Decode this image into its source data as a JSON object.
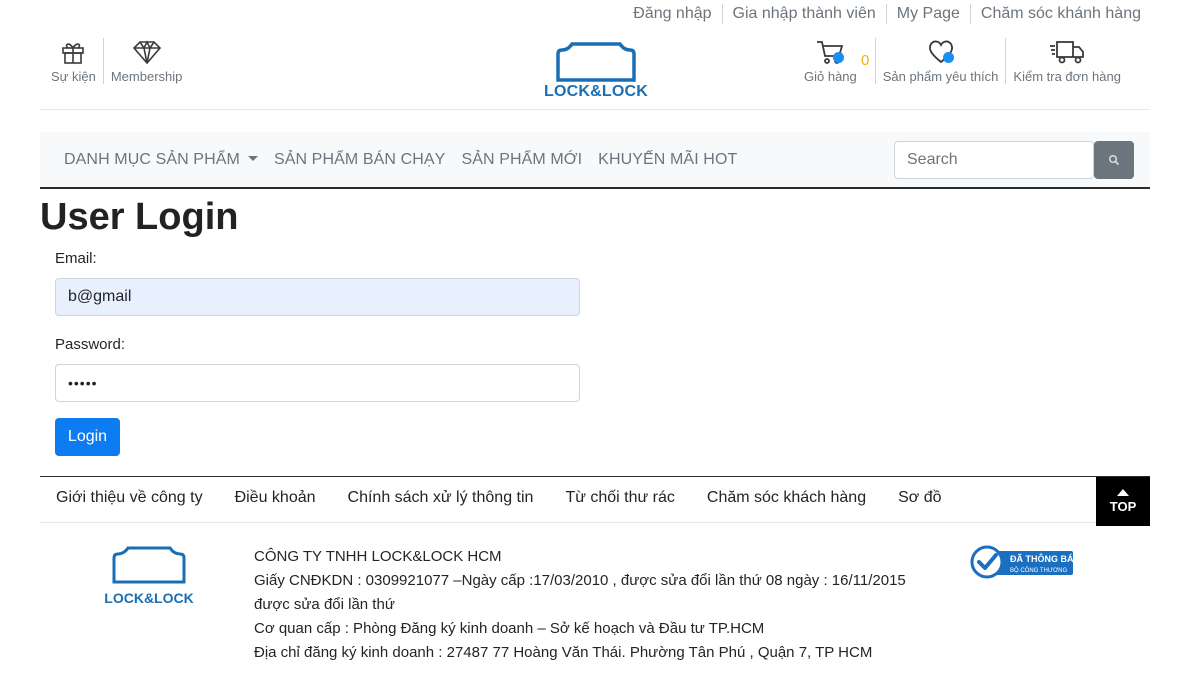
{
  "top_links": [
    "Đăng nhập",
    "Gia nhập thành viên",
    "My Page",
    "Chăm sóc khánh hàng"
  ],
  "header_left": [
    {
      "label": "Sự kiện",
      "icon": "gift-icon"
    },
    {
      "label": "Membership",
      "icon": "diamond-icon"
    }
  ],
  "logo": {
    "brand": "LOCK&LOCK"
  },
  "header_right": [
    {
      "label": "Giỏ hàng",
      "icon": "cart-icon",
      "count": "0"
    },
    {
      "label": "Sản phẩm yêu thích",
      "icon": "heart-icon"
    },
    {
      "label": "Kiểm tra đơn hàng",
      "icon": "truck-icon"
    }
  ],
  "nav": {
    "items": [
      "DANH MỤC SẢN PHẨM",
      "SẢN PHẨM BÁN CHẠY",
      "SẢN PHẨM MỚI",
      "KHUYẾN MÃI HOT"
    ],
    "search_placeholder": "Search"
  },
  "login": {
    "title": "User Login",
    "email_label": "Email:",
    "email_value": "b@gmail",
    "password_label": "Password:",
    "password_value": "•••••",
    "button": "Login"
  },
  "footer": {
    "links": [
      "Giới thiệu về công ty",
      "Điều khoản",
      "Chính sách xử lý thông tin",
      "Từ chối thư rác",
      "Chăm sóc khách hàng",
      "Sơ đồ"
    ],
    "top_label": "TOP",
    "brand": "LOCK&LOCK",
    "company_lines": [
      "CÔNG TY TNHH LOCK&LOCK HCM",
      "Giấy CNĐKDN : 0309921077 –Ngày cấp :17/03/2010 , được sửa đổi lần thứ 08 ngày : 16/11/2015",
      "được sửa đổi lần thứ",
      "Cơ quan cấp : Phòng Đăng ký kinh doanh – Sở kế hoạch và Đầu tư TP.HCM",
      "Địa chỉ đăng ký kinh doanh : 27487 77 Hoàng Văn Thái. Phường Tân Phú , Quận 7, TP HCM"
    ],
    "badge": {
      "line1": "ĐÃ THÔNG BÁO",
      "line2": "BỘ CÔNG THƯƠNG"
    }
  },
  "colors": {
    "brand": "#1a6fb4",
    "primary": "#0d7cf2",
    "muted": "#6c757d",
    "count": "#f0ad0e"
  }
}
